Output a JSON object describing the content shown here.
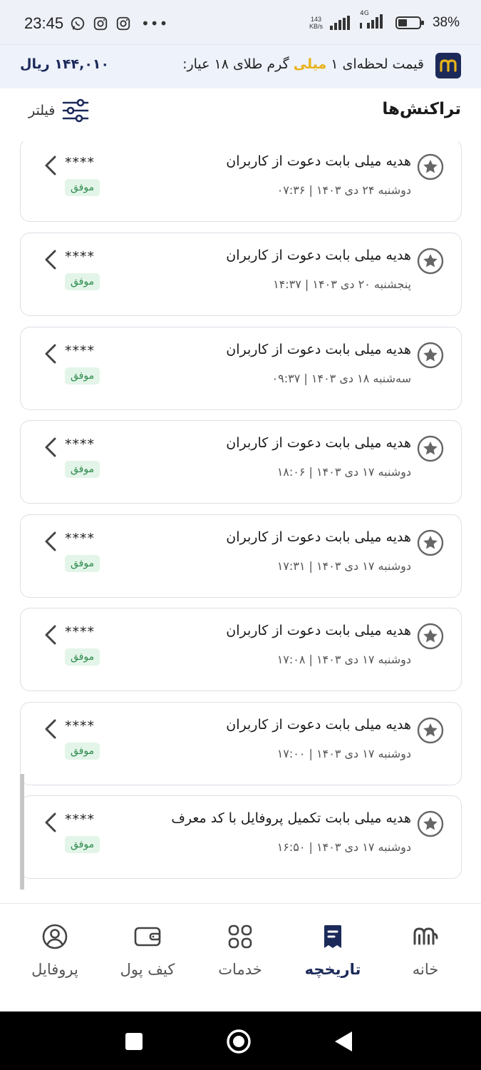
{
  "status_bar": {
    "time": "23:45",
    "net_speed": "143",
    "net_unit": "KB/s",
    "network_type": "4G",
    "battery": "38%"
  },
  "price_banner": {
    "prefix": "قیمت لحظه‌ای ۱",
    "highlight": "میلی",
    "suffix": "گرم طلای ۱۸ عیار:",
    "value": "۱۴۴,۰۱۰ ریال"
  },
  "header": {
    "title": "تراکنش‌ها",
    "filter_label": "فیلتر"
  },
  "transactions": [
    {
      "title": "هدیه میلی بابت دعوت از کاربران",
      "date": "دوشنبه ۲۴ دی ۱۴۰۳ | ۰۷:۳۶",
      "amount": "****",
      "status": "موفق"
    },
    {
      "title": "هدیه میلی بابت دعوت از کاربران",
      "date": "پنجشنبه ۲۰ دی ۱۴۰۳ | ۱۴:۳۷",
      "amount": "****",
      "status": "موفق"
    },
    {
      "title": "هدیه میلی بابت دعوت از کاربران",
      "date": "سه‌شنبه ۱۸ دی ۱۴۰۳ | ۰۹:۳۷",
      "amount": "****",
      "status": "موفق"
    },
    {
      "title": "هدیه میلی بابت دعوت از کاربران",
      "date": "دوشنبه ۱۷ دی ۱۴۰۳ | ۱۸:۰۶",
      "amount": "****",
      "status": "موفق"
    },
    {
      "title": "هدیه میلی بابت دعوت از کاربران",
      "date": "دوشنبه ۱۷ دی ۱۴۰۳ | ۱۷:۳۱",
      "amount": "****",
      "status": "موفق"
    },
    {
      "title": "هدیه میلی بابت دعوت از کاربران",
      "date": "دوشنبه ۱۷ دی ۱۴۰۳ | ۱۷:۰۸",
      "amount": "****",
      "status": "موفق"
    },
    {
      "title": "هدیه میلی بابت دعوت از کاربران",
      "date": "دوشنبه ۱۷ دی ۱۴۰۳ | ۱۷:۰۰",
      "amount": "****",
      "status": "موفق"
    },
    {
      "title": "هدیه میلی بابت تکمیل پروفایل با کد معرف",
      "date": "دوشنبه ۱۷ دی ۱۴۰۳ | ۱۶:۵۰",
      "amount": "****",
      "status": "موفق"
    }
  ],
  "bottom_nav": {
    "home": "خانه",
    "history": "تاریخچه",
    "services": "خدمات",
    "wallet": "کیف پول",
    "profile": "پروفایل",
    "active": "history"
  },
  "colors": {
    "brand": "#1c2a5a",
    "highlight": "#e8b21a",
    "success_bg": "#e3f5e8",
    "success_text": "#2d8a4e"
  }
}
